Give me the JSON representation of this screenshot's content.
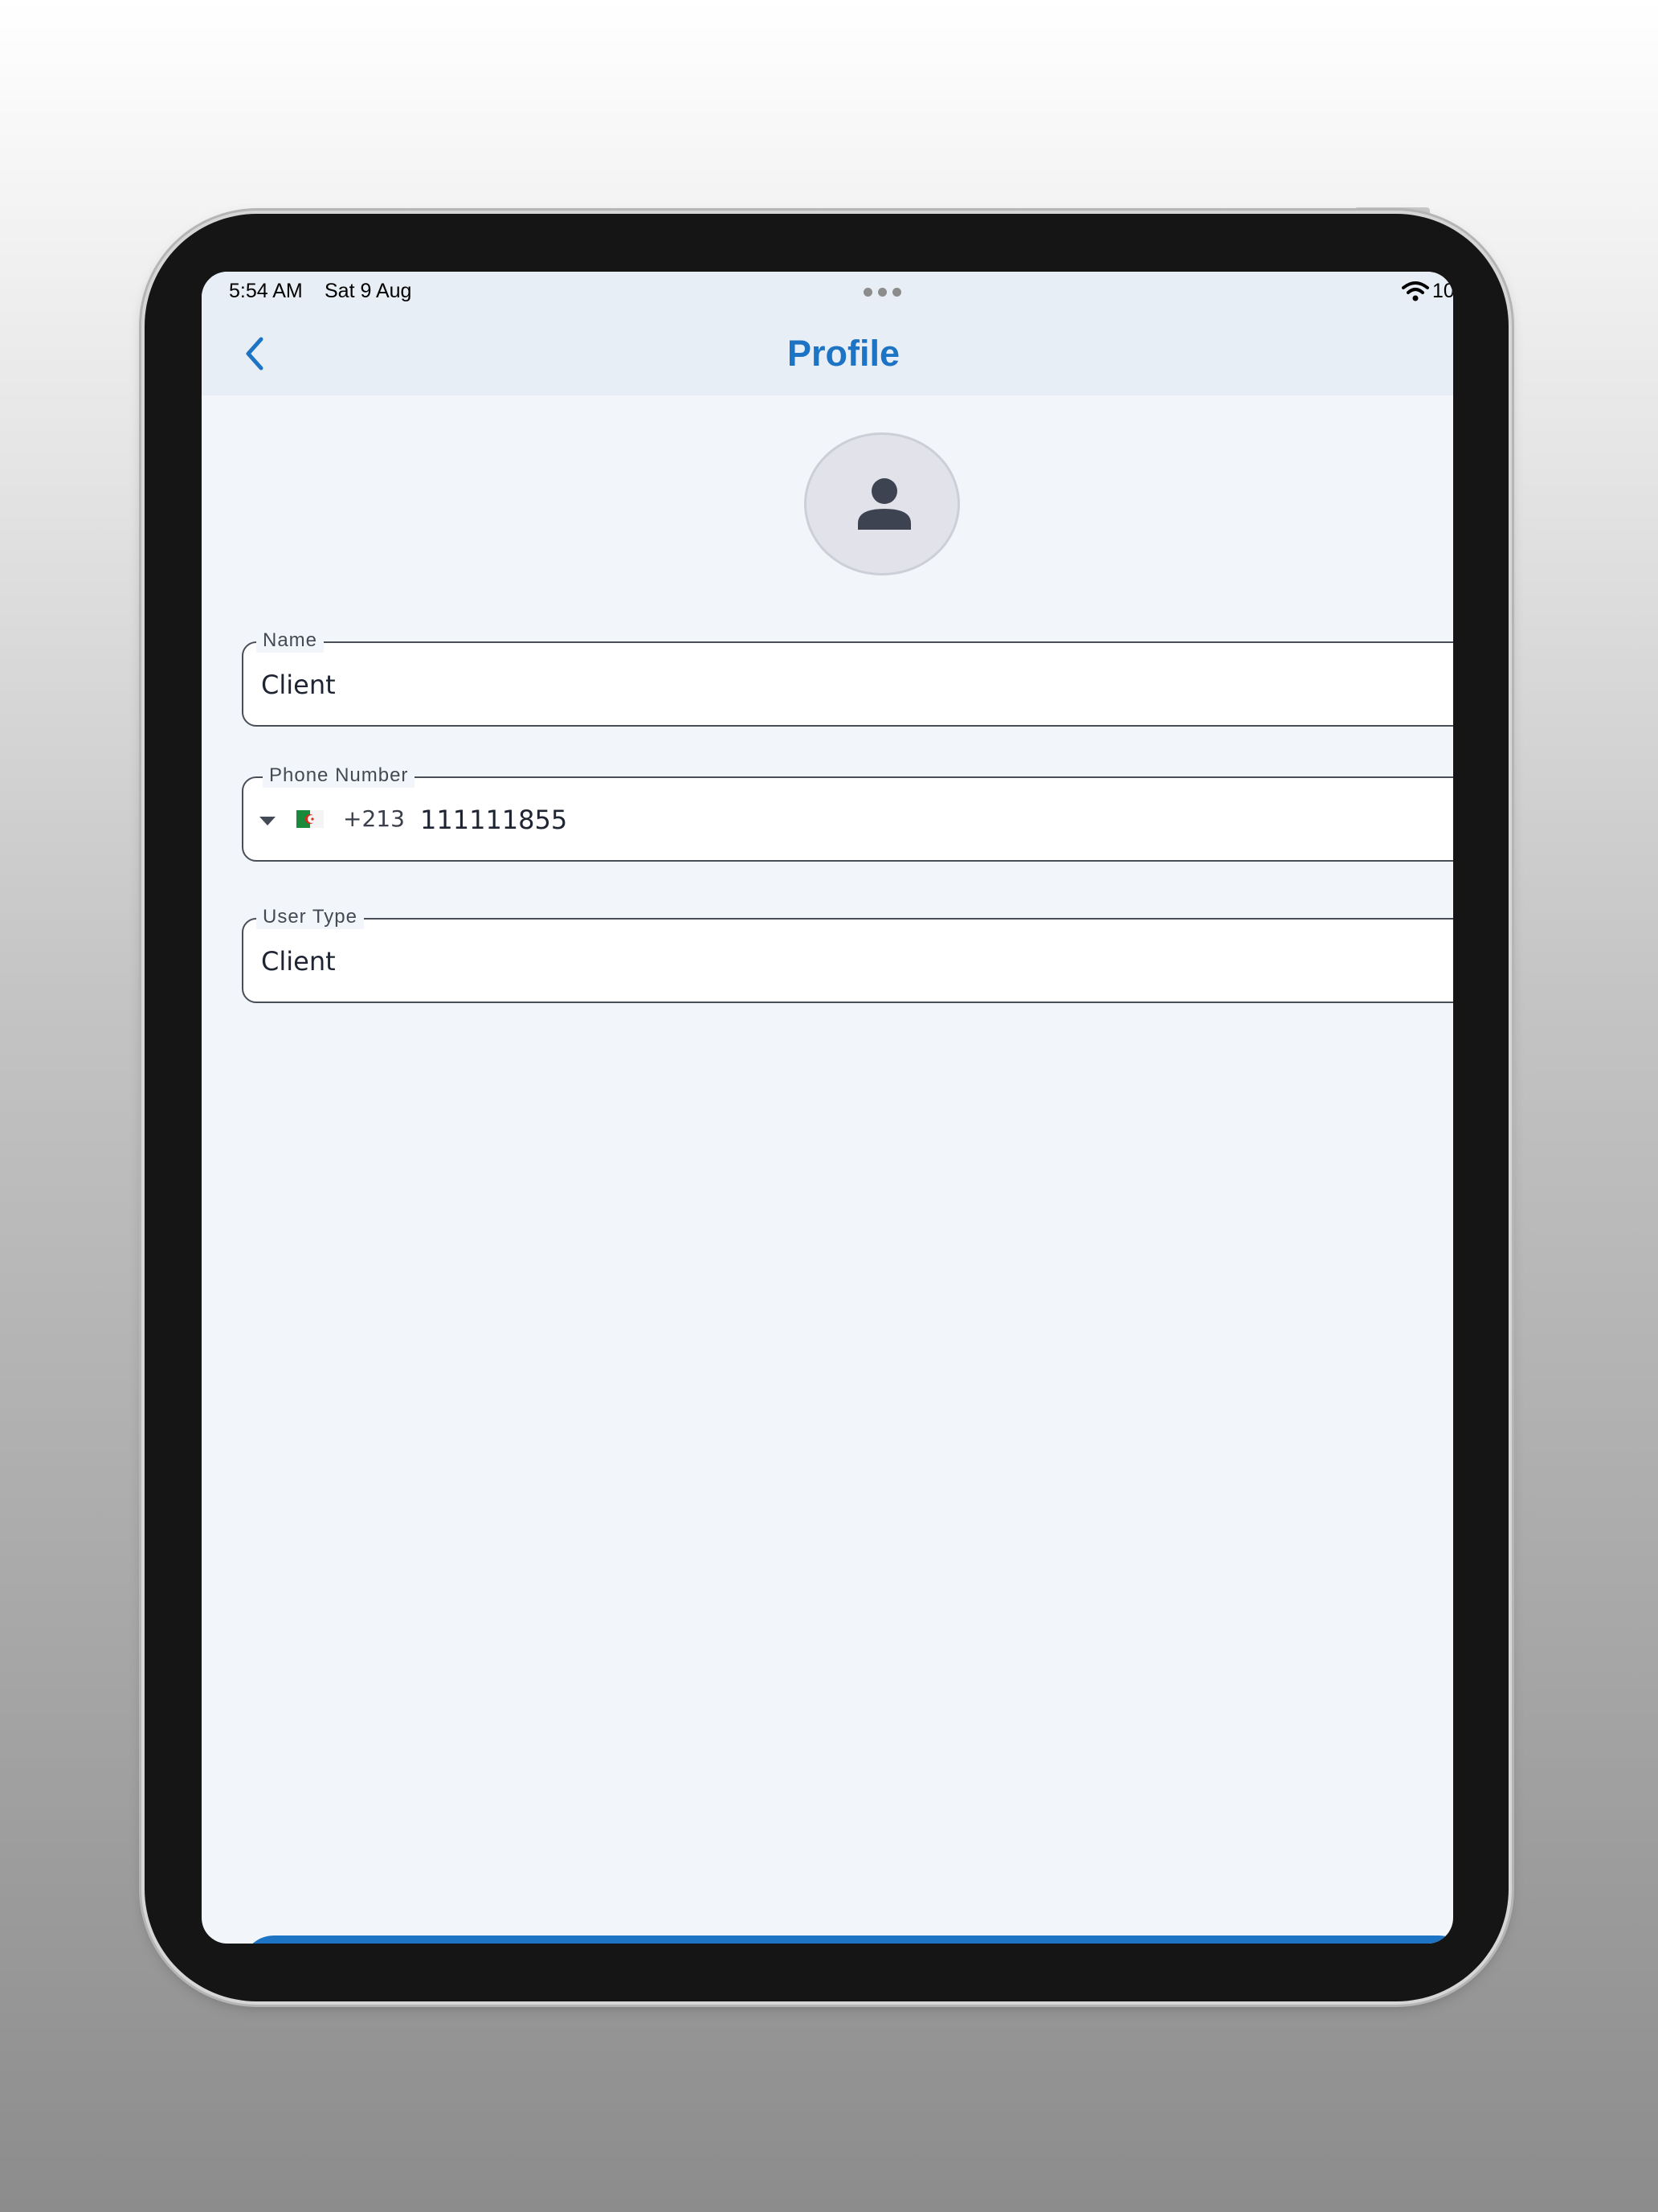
{
  "status_bar": {
    "time": "5:54 AM",
    "date": "Sat 9 Aug",
    "battery": "10"
  },
  "header": {
    "title": "Profile",
    "back_icon": "chevron-left-icon"
  },
  "avatar": {
    "icon": "person-icon"
  },
  "form": {
    "name": {
      "label": "Name",
      "value": "Client"
    },
    "phone": {
      "label": "Phone Number",
      "country_flag": "algeria-flag-icon",
      "dial_code": "+213",
      "value": "111111855"
    },
    "user_type": {
      "label": "User Type",
      "value": "Client"
    }
  },
  "colors": {
    "accent": "#1e74c4",
    "header_background": "#e8eef5",
    "page_background": "#f2f6fa",
    "field_border": "#4a4e57"
  }
}
